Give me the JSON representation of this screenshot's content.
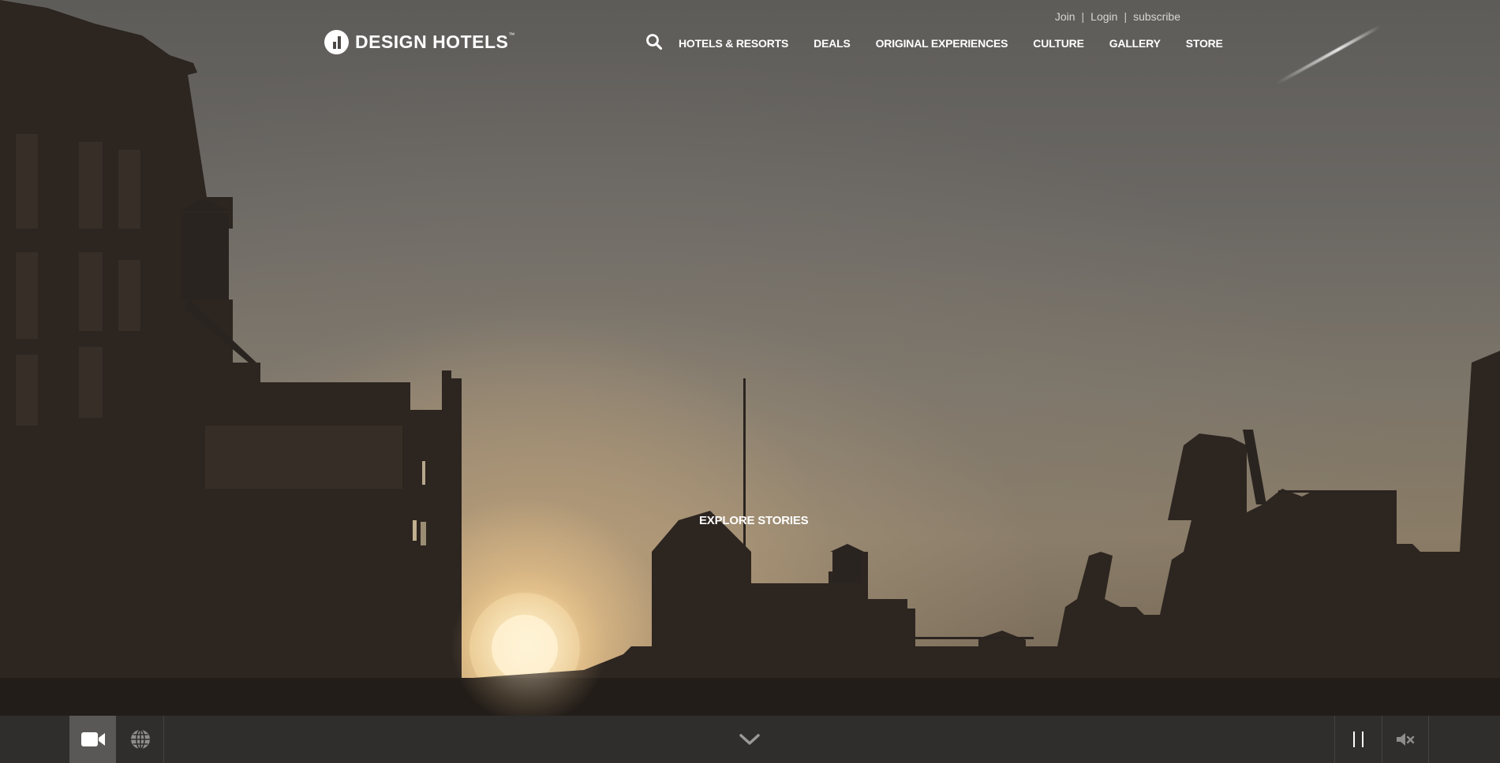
{
  "utility": {
    "join": "Join",
    "login": "Login",
    "subscribe": "subscribe",
    "separator": "|"
  },
  "logo": {
    "text": "DESIGN HOTELS",
    "trademark": "™"
  },
  "nav": {
    "search_icon": "search-icon",
    "items": [
      {
        "label": "HOTELS & RESORTS"
      },
      {
        "label": "DEALS"
      },
      {
        "label": "ORIGINAL EXPERIENCES"
      },
      {
        "label": "CULTURE"
      },
      {
        "label": "GALLERY"
      },
      {
        "label": "STORE"
      }
    ]
  },
  "hero": {
    "cta": "EXPLORE STORIES"
  },
  "bottom_bar": {
    "video_icon": "video-camera-icon",
    "globe_icon": "globe-icon",
    "scroll_icon": "chevron-down-icon",
    "pause_icon": "pause-icon",
    "mute_icon": "speaker-muted-icon",
    "active_view": "video"
  },
  "colors": {
    "bar_background": "#2f2e2d",
    "active_button": "#5a5856",
    "text": "#ffffff"
  }
}
